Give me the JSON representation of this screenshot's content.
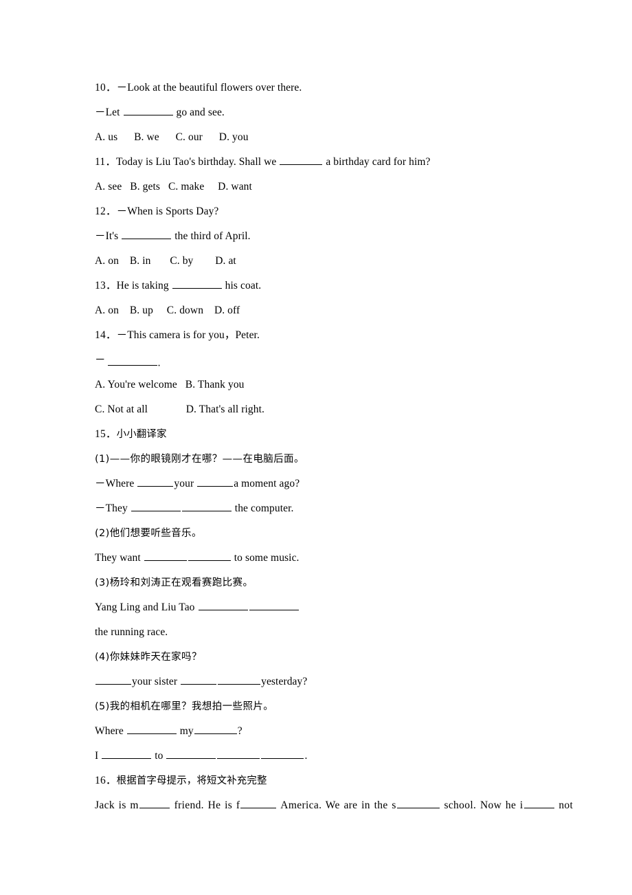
{
  "document": {
    "type": "english-exercise-worksheet",
    "language": "en-zh"
  },
  "questions": [
    {
      "number": "10．",
      "lines": [
        "－Look at the beautiful flowers over there.",
        "－Let ________ go and see."
      ],
      "options_line": "A. us      B. we      C. our      D. you"
    },
    {
      "number": "11．",
      "stem_pre": "Today is Liu Tao's birthday. Shall we ",
      "stem_post": " a birthday card for him?",
      "options_line": "A. see   B. gets   C. make     D. want"
    },
    {
      "number": "12．",
      "lines": [
        "－When is Sports Day?",
        "－It's ________ the third of April."
      ],
      "options_line": "A. on    B. in       C. by        D. at"
    },
    {
      "number": "13．",
      "stem_pre": "He is taking ",
      "stem_post": " his coat.",
      "options_line": "A. on    B. up     C. down    D. off"
    },
    {
      "number": "14．",
      "lines": [
        "－This camera is for you，Peter.",
        "－________."
      ],
      "options_line_1": "A. You're welcome   B. Thank you",
      "options_line_2": "C. Not at all              D. That's all right."
    },
    {
      "number": "15．",
      "title": "小小翻译家",
      "items": [
        {
          "label": "(1)",
          "chinese": "——你的眼镜刚才在哪？——在电脑后面。",
          "answer_lines": [
            "－Where ______your ______a moment ago?",
            "－They ________ ________ the computer."
          ]
        },
        {
          "label": "(2)",
          "chinese": "他们想要听些音乐。",
          "answer_lines": [
            "They want _______ _______ to some music."
          ]
        },
        {
          "label": "(3)",
          "chinese": "杨玲和刘涛正在观看赛跑比赛。",
          "answer_lines": [
            "Yang Ling and Liu Tao ________ ________",
            "the running race."
          ]
        },
        {
          "label": "(4)",
          "chinese": "你妹妹昨天在家吗？",
          "answer_lines": [
            "______your sister ______ _______ yesterday?"
          ]
        },
        {
          "label": "(5)",
          "chinese": "我的相机在哪里？我想拍一些照片。",
          "answer_lines": [
            "Where ________ my________?",
            "I ________ to ________ _______ _______."
          ]
        }
      ]
    },
    {
      "number": "16．",
      "title": "根据首字母提示，将短文补充完整",
      "passage_line": "Jack is m____ friend. He is f_____ America. We are in the s______ school. Now he i____ not"
    }
  ],
  "labels": {
    "q10_line1": "－Look at the beautiful flowers over there.",
    "q10_line2_pre": "－Let ",
    "q10_line2_post": " go and see.",
    "q10_options": "A. us      B. we      C. our      D. you",
    "q11_pre": "Today is Liu Tao's birthday. Shall we ",
    "q11_post": " a birthday card for him?",
    "q11_options": "A. see   B. gets   C. make     D. want",
    "q12_line1": "－When is Sports Day?",
    "q12_line2_pre": "－It's ",
    "q12_line2_post": " the third of April.",
    "q12_options": "A. on    B. in       C. by        D. at",
    "q13_pre": "He is taking ",
    "q13_post": " his coat.",
    "q13_options": "A. on    B. up     C. down    D. off",
    "q14_line1": "－This camera is for you，Peter.",
    "q14_dash": "－",
    "q14_dot": ".",
    "q14_options_1": "A. You're welcome   B. Thank you",
    "q14_options_2": "C. Not at all              D. That's all right.",
    "q15_title": "小小翻译家",
    "i1_label": "(1)",
    "i1_cn": "——你的眼镜刚才在哪？——在电脑后面。",
    "i1_a_pre": "－Where ",
    "i1_a_mid": "your ",
    "i1_a_post": "a moment ago?",
    "i1_b_pre": "－They ",
    "i1_b_post": " the computer.",
    "i2_label": "(2)",
    "i2_cn": "他们想要听些音乐。",
    "i2_a_pre": "They want ",
    "i2_a_post": " to some music.",
    "i3_label": "(3)",
    "i3_cn": "杨玲和刘涛正在观看赛跑比赛。",
    "i3_a_pre": "Yang Ling and Liu Tao ",
    "i3_b": "the running race.",
    "i4_label": "(4)",
    "i4_cn": "你妹妹昨天在家吗？",
    "i4_a_mid": "your sister ",
    "i4_a_post": "yesterday?",
    "i5_label": "(5)",
    "i5_cn": "我的相机在哪里？我想拍一些照片。",
    "i5_a_pre": "Where ",
    "i5_a_mid": " my",
    "i5_a_post": "?",
    "i5_b_pre": "I ",
    "i5_b_mid": " to ",
    "i5_b_post": ".",
    "q16_title": "根据首字母提示，将短文补充完整",
    "q16_s1": "Jack is m",
    "q16_s2": " friend. He is f",
    "q16_s3": " America. We are in the s",
    "q16_s4": " school. Now he i",
    "q16_s5": " not",
    "num10": "10．",
    "num11": "11．",
    "num12": "12．",
    "num13": "13．",
    "num14": "14．",
    "num15": "15．",
    "num16": "16．"
  }
}
